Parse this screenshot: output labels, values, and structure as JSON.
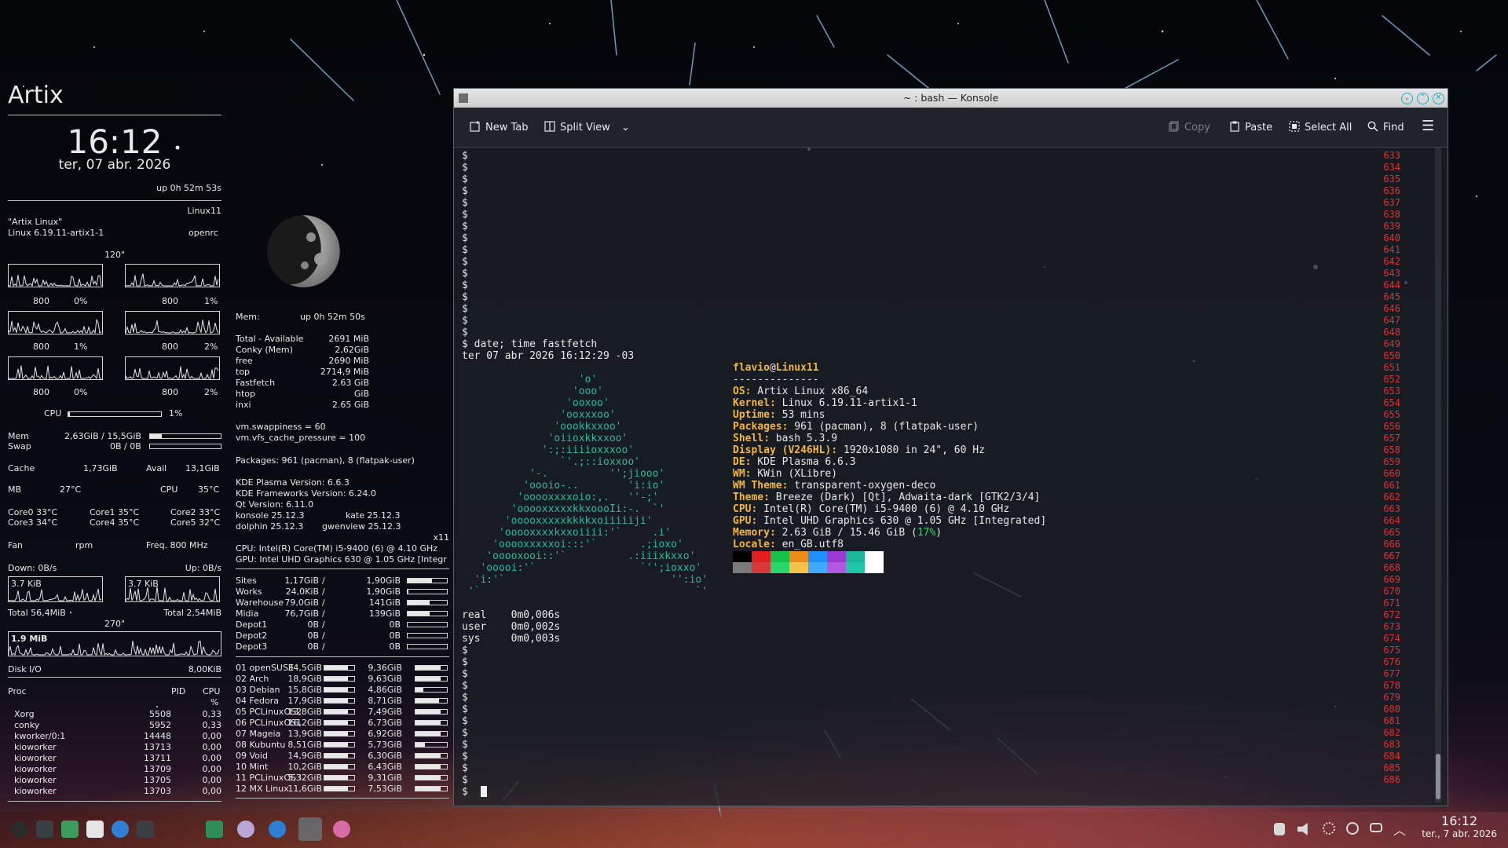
{
  "conky_left": {
    "distro": "Artix",
    "time": "16:12",
    "date": "ter, 07 abr. 2026",
    "uptime": "up  0h 52m 53s",
    "hostname": "Linux11",
    "os_name": "\"Artix Linux\"",
    "kernel": "Linux 6.19.11-artix1-1",
    "init": "openrc",
    "cpu_span": "120\"",
    "cores": [
      {
        "freq": "800",
        "pct": "0%"
      },
      {
        "freq": "800",
        "pct": "1%"
      },
      {
        "freq": "800",
        "pct": "1%"
      },
      {
        "freq": "800",
        "pct": "2%"
      },
      {
        "freq": "800",
        "pct": "0%"
      },
      {
        "freq": "800",
        "pct": "2%"
      }
    ],
    "cpu_label": "CPU",
    "cpu_pct": "1%",
    "cpu_fill": 0.02,
    "mem_label": "Mem",
    "mem_value": "2,63GiB / 15,5GiB",
    "mem_fill": 0.17,
    "swap_label": "Swap",
    "swap_value": "0B / 0B",
    "swap_fill": 0,
    "cache_label": "Cache",
    "cache_value": "1,73GiB",
    "avail_label": "Avail",
    "avail_value": "13,1GiB",
    "mb_label": "MB",
    "mb_temp": "27°C",
    "cpu_temp_label": "CPU",
    "cpu_temp": "35°C",
    "core_temps": [
      "Core0  33°C",
      "Core1  35°C",
      "Core2  33°C",
      "Core3  34°C",
      "Core4  35°C",
      "Core5  32°C"
    ],
    "fan_label": "Fan",
    "fan_unit": "rpm",
    "freq_label": "Freq.  800    MHz",
    "down": "Down: 0B/s",
    "up": "Up: 0B/s",
    "down_graph": "3.7 KiB",
    "up_graph": "3.7 KiB",
    "total_down": "Total 56,4MiB",
    "total_up": "Total 2,54MiB",
    "disk_span": "270\"",
    "disk_graph": "1.9 MiB",
    "disk_label": "Disk I/O",
    "disk_value": "8,00KiB",
    "proc_header": {
      "proc": "Proc",
      "pid": "PID",
      "cpu": "CPU",
      "pct": "%"
    },
    "procs": [
      {
        "name": "Xorg",
        "pid": "5508",
        "cpu": "0,33"
      },
      {
        "name": "conky",
        "pid": "5952",
        "cpu": "0,33"
      },
      {
        "name": "kworker/0:1",
        "pid": "14448",
        "cpu": "0,00"
      },
      {
        "name": "kioworker",
        "pid": "13713",
        "cpu": "0,00"
      },
      {
        "name": "kioworker",
        "pid": "13711",
        "cpu": "0,00"
      },
      {
        "name": "kioworker",
        "pid": "13709",
        "cpu": "0,00"
      },
      {
        "name": "kioworker",
        "pid": "13705",
        "cpu": "0,00"
      },
      {
        "name": "kioworker",
        "pid": "13703",
        "cpu": "0,00"
      }
    ]
  },
  "conky_right": {
    "mem_title": "Mem:",
    "uptime": "up  0h 52m 50s",
    "mem_rows": [
      {
        "k": "Total - Available",
        "v": "2691 MiB"
      },
      {
        "k": "Conky (Mem)",
        "v": "2,62GiB"
      },
      {
        "k": "free",
        "v": "2690     MiB"
      },
      {
        "k": "top",
        "v": "2714,9  MiB"
      },
      {
        "k": "Fastfetch",
        "v": "2.63 GiB"
      },
      {
        "k": "htop",
        "v": "GiB"
      },
      {
        "k": "inxi",
        "v": "2.65 GiB"
      }
    ],
    "swappiness": "vm.swappiness = 60",
    "cache_pressure": "vm.vfs_cache_pressure = 100",
    "packages": "Packages: 961 (pacman), 8 (flatpak-user)",
    "plasma": "KDE Plasma Version: 6.6.3",
    "frameworks": "KDE Frameworks Version: 6.24.0",
    "qt": "Qt Version: 6.11.0",
    "konsole": "konsole 25.12.3",
    "kate": "kate 25.12.3",
    "dolphin": "dolphin 25.12.3",
    "gwenview": "gwenview 25.12.3",
    "session": "x11",
    "cpu": "CPU: Intel(R) Core(TM) i5-9400 (6) @ 4.10 GHz",
    "gpu": "GPU: Intel UHD Graphics 630 @ 1.05 GHz [Integr",
    "drives": [
      {
        "name": "Sites",
        "used": "1,17GiB",
        "total": "1,90GiB",
        "fill": 0.62
      },
      {
        "name": "Works",
        "used": "24,0KiB",
        "total": "1,90GiB",
        "fill": 0.02
      },
      {
        "name": "Warehouse",
        "used": "79,0GiB",
        "total": "141GiB",
        "fill": 0.56
      },
      {
        "name": "Midia",
        "used": "76,7GiB",
        "total": "139GiB",
        "fill": 0.55
      },
      {
        "name": "Depot1",
        "used": "0B",
        "total": "0B",
        "fill": 0
      },
      {
        "name": "Depot2",
        "used": "0B",
        "total": "0B",
        "fill": 0
      },
      {
        "name": "Depot3",
        "used": "0B",
        "total": "0B",
        "fill": 0
      }
    ],
    "distros": [
      {
        "name": "01 openSUSE",
        "size": "34,5GiB",
        "fill": 0.8,
        "free": "9,36GiB",
        "fill2": 0.8
      },
      {
        "name": "02 Arch",
        "size": "18,9GiB",
        "fill": 0.8,
        "free": "9,63GiB",
        "fill2": 0.8
      },
      {
        "name": "03 Debian",
        "size": "15,8GiB",
        "fill": 0.8,
        "free": "4,86GiB",
        "fill2": 0.25
      },
      {
        "name": "04 Fedora",
        "size": "17,9GiB",
        "fill": 0.8,
        "free": "8,71GiB",
        "fill2": 0.75
      },
      {
        "name": "05 PCLinuxOS2",
        "size": "13,8GiB",
        "fill": 0.8,
        "free": "7,49GiB",
        "fill2": 0.8
      },
      {
        "name": "06 PCLinuxOS1",
        "size": "16,2GiB",
        "fill": 0.8,
        "free": "6,73GiB",
        "fill2": 0.8
      },
      {
        "name": "07 Mageia",
        "size": "13,9GiB",
        "fill": 0.8,
        "free": "6,92GiB",
        "fill2": 0.8
      },
      {
        "name": "08 Kubuntu",
        "size": "8,51GiB",
        "fill": 0.8,
        "free": "5,73GiB",
        "fill2": 0.3
      },
      {
        "name": "09 Void",
        "size": "14,9GiB",
        "fill": 0.8,
        "free": "6,30GiB",
        "fill2": 0.8
      },
      {
        "name": "10 Mint",
        "size": "10,2GiB",
        "fill": 0.8,
        "free": "6,43GiB",
        "fill2": 0.8
      },
      {
        "name": "11 PCLinuxOS3",
        "size": "5,32GiB",
        "fill": 0.8,
        "free": "9,31GiB",
        "fill2": 0.8
      },
      {
        "name": "12 MX Linux",
        "size": "11,6GiB",
        "fill": 0.8,
        "free": "7,53GiB",
        "fill2": 0.8
      }
    ]
  },
  "konsole": {
    "title": "~ : bash — Konsole",
    "toolbar": {
      "new_tab": "New Tab",
      "split_view": "Split View",
      "copy": "Copy",
      "paste": "Paste",
      "select_all": "Select All",
      "find": "Find"
    },
    "line_numbers": [
      "633",
      "634",
      "635",
      "636",
      "637",
      "638",
      "639",
      "640",
      "641",
      "642",
      "643",
      "644",
      "645",
      "646",
      "647",
      "648",
      "649",
      "650",
      "651",
      "652",
      "653",
      "654",
      "655",
      "656",
      "657",
      "658",
      "659",
      "660",
      "661",
      "662",
      "663",
      "664",
      "665",
      "666",
      "667",
      "668",
      "669",
      "670",
      "671",
      "672",
      "673",
      "674",
      "675",
      "676",
      "677",
      "678",
      "679",
      "680",
      "681",
      "682",
      "683",
      "684",
      "685",
      "686"
    ],
    "prompt": "$",
    "command": "$ date; time fastfetch",
    "date_output": "ter 07 abr 2026 16:12:29 -03",
    "logo_lines": [
      "                   'o'",
      "                  'ooo'",
      "                 'ooxoo'",
      "                'ooxxxoo'",
      "               'oookkxxoo'",
      "              'oiioxkkxxoo'",
      "             ':;:iiiioxxxoo'",
      "                `'.;::ioxxoo'",
      "           '-.          '';jiooo'",
      "          'oooio-..        'i:io'",
      "         'ooooxxxxoio:,.   ''-;'",
      "        'ooooxxxxxkkxoooIi:-.  `'",
      "       'ooooxxxxxkkkkxoiiiiiji'",
      "      'ooooxxxxkxxoiiii:'`     .i'",
      "     'ooooxxxxxoi:::'`       .;ioxo'",
      "    'ooooxooi::'`          .:iiixkxxo'",
      "   'ooooi:'`                 `'';ioxxo'",
      "  'i:'`                           '':io'",
      " '`                                   `'"
    ],
    "fetch_user": "flavio",
    "fetch_at": "@",
    "fetch_host": "Linux11",
    "fetch_sep": "--------------",
    "fetch": [
      {
        "k": "OS",
        "v": " Artix Linux x86_64"
      },
      {
        "k": "Kernel",
        "v": " Linux 6.19.11-artix1-1"
      },
      {
        "k": "Uptime",
        "v": " 53 mins"
      },
      {
        "k": "Packages",
        "v": " 961 (pacman), 8 (flatpak-user)"
      },
      {
        "k": "Shell",
        "v": " bash 5.3.9"
      },
      {
        "k": "Display (V246HL)",
        "v": " 1920x1080 in 24\", 60 Hz"
      },
      {
        "k": "DE",
        "v": " KDE Plasma 6.6.3"
      },
      {
        "k": "WM",
        "v": " KWin (XLibre)"
      },
      {
        "k": "WM Theme",
        "v": " transparent-oxygen-deco"
      },
      {
        "k": "Theme",
        "v": " Breeze (Dark) [Qt], Adwaita-dark [GTK2/3/4]"
      },
      {
        "k": "CPU",
        "v": " Intel(R) Core(TM) i5-9400 (6) @ 4.10 GHz"
      },
      {
        "k": "GPU",
        "v": " Intel UHD Graphics 630 @ 1.05 GHz [Integrated]"
      },
      {
        "k": "Memory",
        "v": " 2.63 GiB / 15.46 GiB ("
      },
      {
        "k": "Locale",
        "v": " en_GB.utf8"
      }
    ],
    "mem_pct": "17%",
    "mem_close": ")",
    "palette_top": [
      "#000000",
      "#e11d1d",
      "#17c24b",
      "#f08a18",
      "#1e90ff",
      "#9b3ad1",
      "#1bb59a",
      "#ffffff"
    ],
    "palette_bottom": [
      "#7a7a7a",
      "#d83a3a",
      "#2ad56a",
      "#f6c24a",
      "#3fa8ff",
      "#b05ae0",
      "#20c4a8",
      "#ffffff"
    ],
    "real": "real    0m0,006s",
    "user": "user    0m0,002s",
    "sys": "sys     0m0,003s"
  },
  "panel": {
    "time": "16:12",
    "date": "ter., 7 abr. 2026"
  }
}
